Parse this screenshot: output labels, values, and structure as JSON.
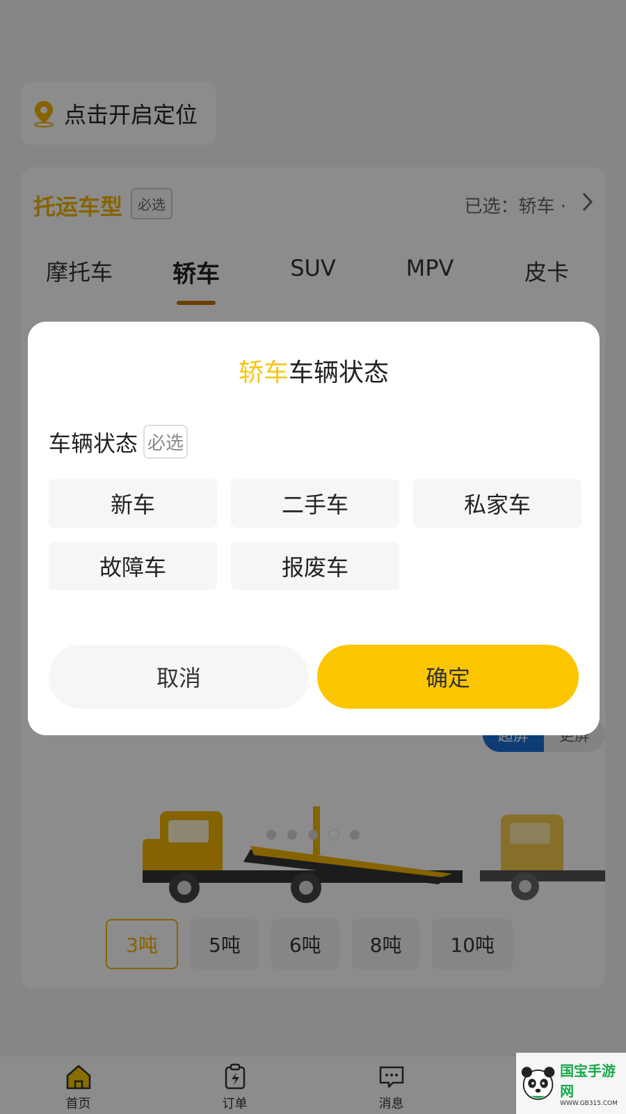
{
  "location": {
    "label": "点击开启定位"
  },
  "vehicle_type": {
    "title": "托运车型",
    "required_tag": "必选",
    "selected_info": "已选：轿车 ·",
    "tabs": [
      "摩托车",
      "轿车",
      "SUV",
      "MPV",
      "皮卡"
    ],
    "active_tab": "轿车"
  },
  "truck_toggle": {
    "on": "超屏",
    "off": "更屏"
  },
  "tonnage": [
    "3吨",
    "5吨",
    "6吨",
    "8吨",
    "10吨"
  ],
  "dialog": {
    "title_accent": "轿车",
    "title_rest": "车辆状态",
    "field_label": "车辆状态",
    "required_tag": "必选",
    "options": [
      "新车",
      "二手车",
      "私家车",
      "故障车",
      "报废车"
    ],
    "cancel": "取消",
    "confirm": "确定"
  },
  "bottom_nav": [
    {
      "label": "首页",
      "icon": "home-icon"
    },
    {
      "label": "订单",
      "icon": "order-icon"
    },
    {
      "label": "消息",
      "icon": "message-icon"
    },
    {
      "label": "",
      "icon": "profile-icon"
    }
  ],
  "watermark": {
    "main": "国宝手游网",
    "sub": "WWW.GB315.COM"
  },
  "colors": {
    "accent": "#FBC600",
    "brand_blue": "#1A6FD6",
    "underline": "#C5740C"
  }
}
